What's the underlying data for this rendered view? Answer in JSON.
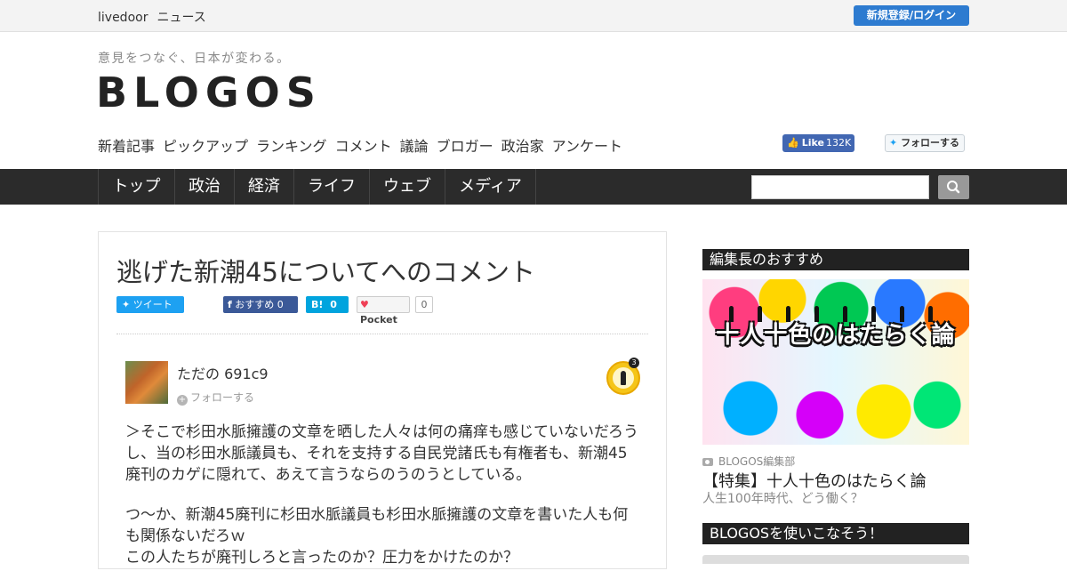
{
  "topbar": {
    "brand_livedoor": "livedoor",
    "brand_news": "ニュース",
    "login_button": "新規登録/ログイン"
  },
  "header": {
    "tagline": "意見をつなぐ、日本が変わる。",
    "logo": "BLOGOS",
    "subnav": [
      "新着記事",
      "ピックアップ",
      "ランキング",
      "コメント",
      "議論",
      "ブロガー",
      "政治家",
      "アンケート"
    ],
    "facebook_like": {
      "label": "Like",
      "count": "132K"
    },
    "twitter_follow": "フォローする"
  },
  "mainnav": {
    "items": [
      "トップ",
      "政治",
      "経済",
      "ライフ",
      "ウェブ",
      "メディア"
    ],
    "search": {
      "placeholder": ""
    }
  },
  "article": {
    "title": "逃げた新潮45についてへのコメント",
    "share": {
      "tweet": "ツイート",
      "fb_recommend": "おすすめ",
      "fb_count": "0",
      "hatena_label": "B!",
      "hatena_count": "0",
      "pocket_label": "Pocket",
      "pocket_count": "0"
    },
    "author": {
      "name": "ただの 691c9",
      "follow": "フォローする",
      "badge_count": "3"
    },
    "comment_paragraphs": [
      "＞そこで杉田水脈擁護の文章を晒した人々は何の痛痒も感じていないだろうし、当の杉田水脈議員も、それを支持する自民党諸氏も有権者も、新潮45廃刊のカゲに隠れて、あえて言うならのうのうとしている。",
      "つ～か、新潮45廃刊に杉田水脈議員も杉田水脈擁護の文章を書いた人も何も関係ないだろｗ",
      "この人たちが廃刊しろと言ったのか？圧力をかけたのか？"
    ]
  },
  "sidebar": {
    "editor_pick_heading": "編集長のおすすめ",
    "feature_image_text": "十人十色のはたらく論",
    "feature_author": "BLOGOS編集部",
    "feature_headline": "【特集】十人十色のはたらく論",
    "feature_sub": "人生100年時代、どう働く？",
    "howto_heading": "BLOGOSを使いこなそう！"
  },
  "colors": {
    "login_button": "#2d7bd0",
    "nav_bg": "#2b2b2b",
    "twitter": "#1da1f2",
    "facebook": "#3b5998",
    "hatena": "#00a4de"
  }
}
